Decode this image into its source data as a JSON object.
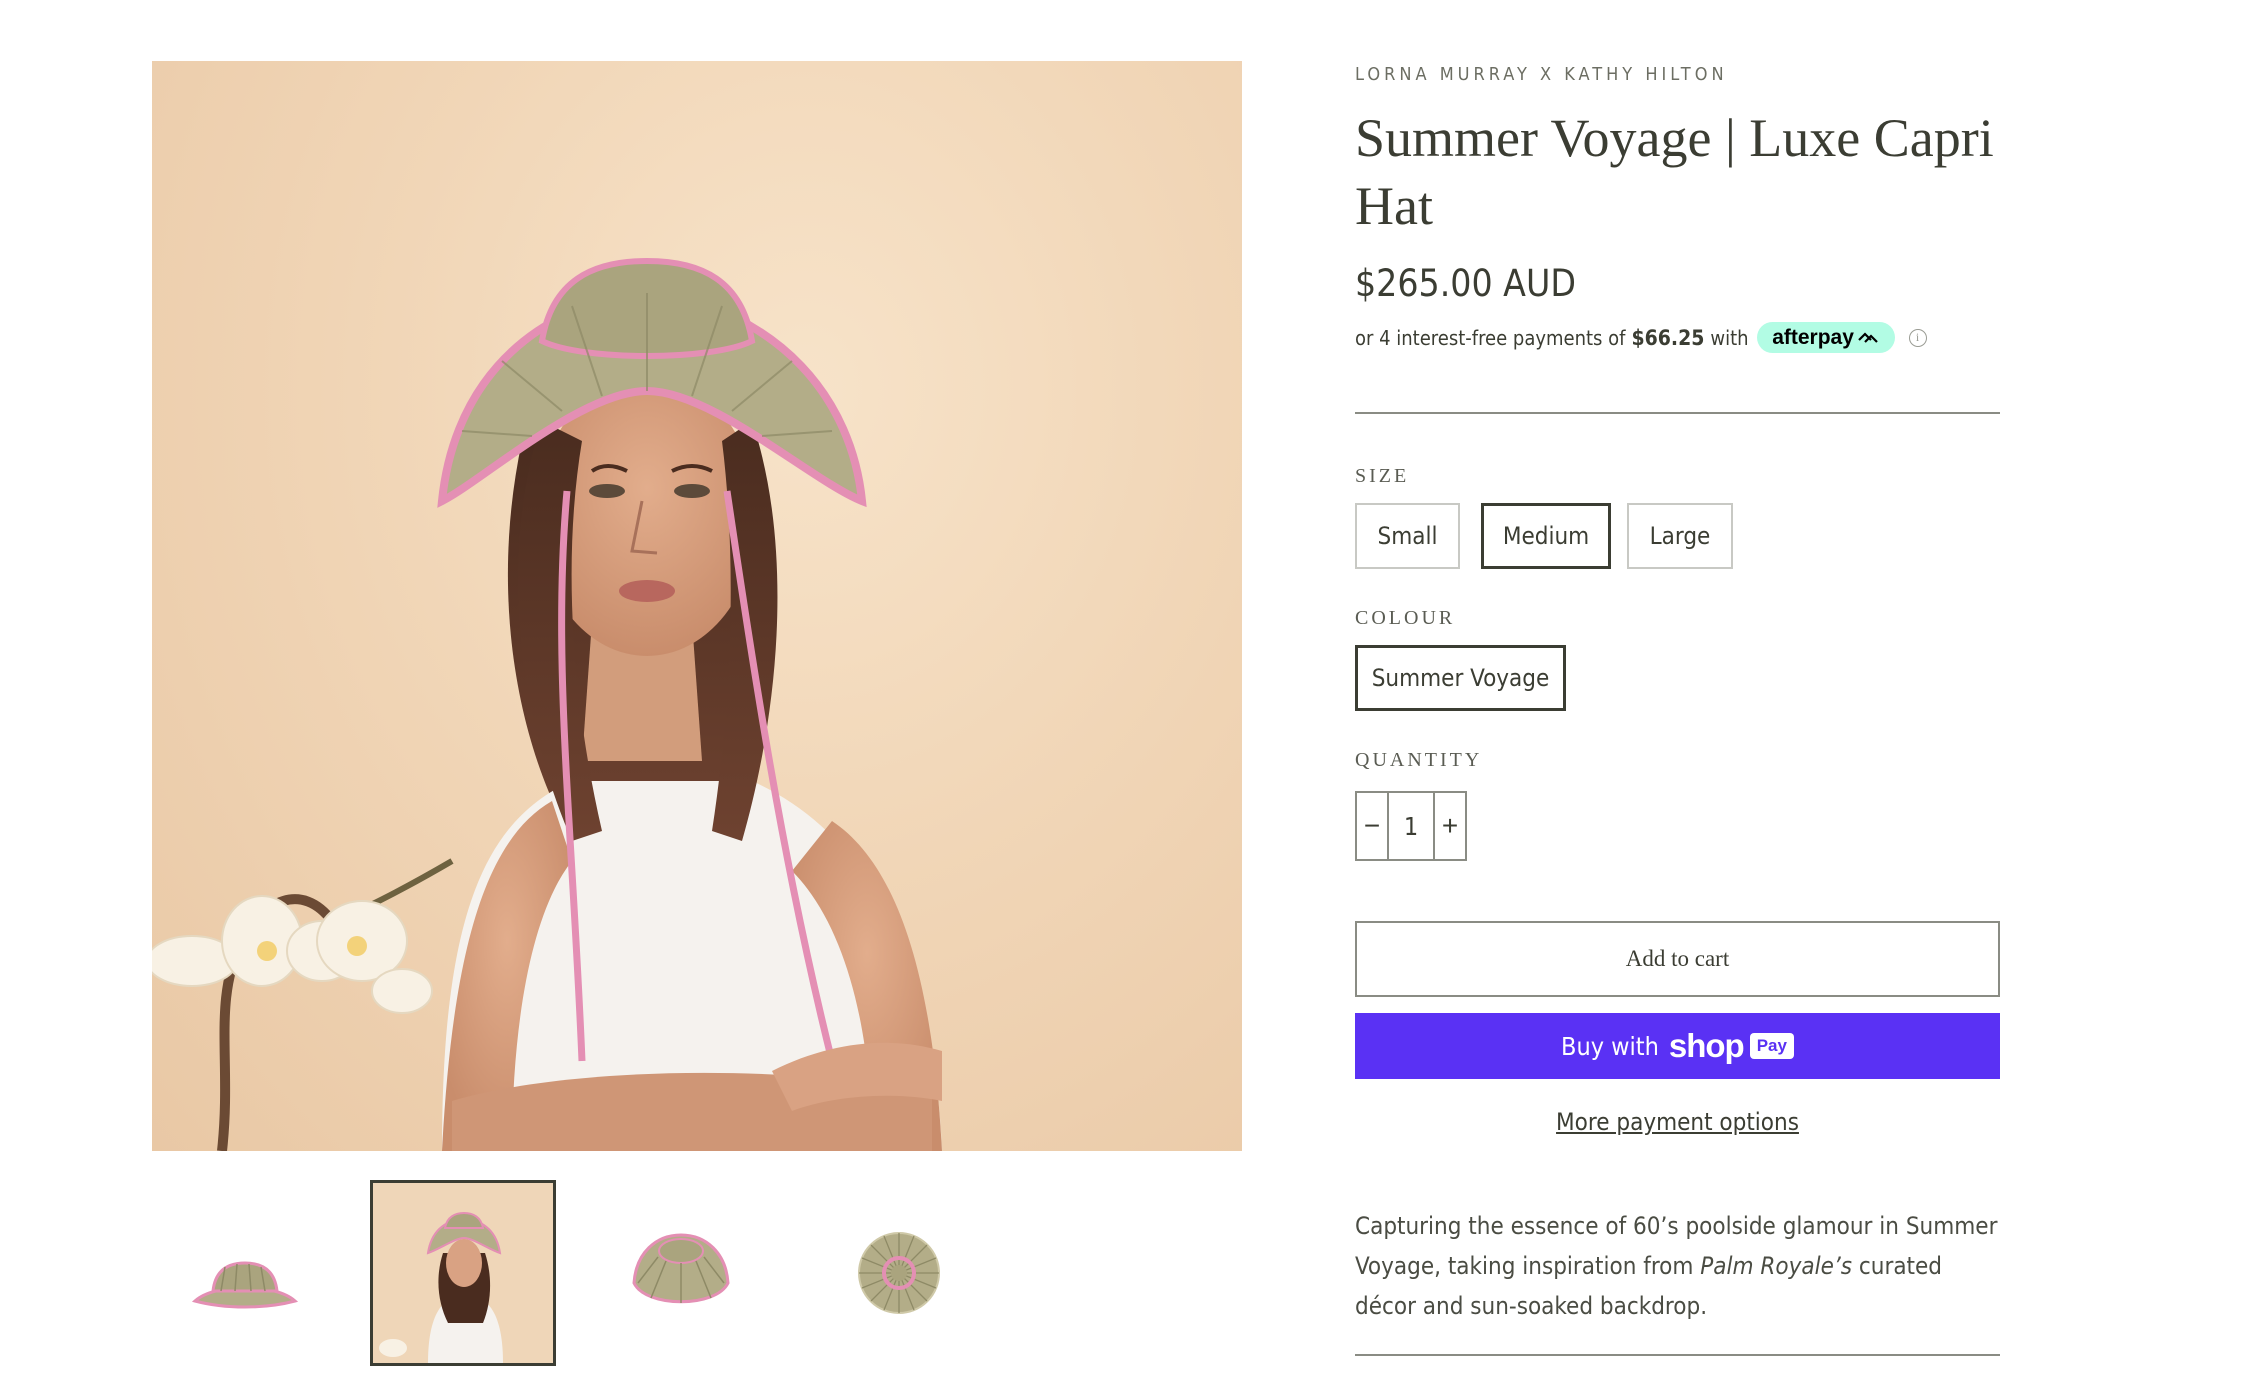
{
  "product": {
    "vendor": "LORNA MURRAY X KATHY HILTON",
    "title": "Summer Voyage | Luxe Capri Hat",
    "price": "$265.00 AUD",
    "afterpay": {
      "prefix": "or 4 interest-free payments of",
      "amount": "$66.25",
      "suffix": "with",
      "brand": "afterpay",
      "info": "i"
    }
  },
  "options": {
    "size": {
      "label": "SIZE",
      "values": [
        "Small",
        "Medium",
        "Large"
      ],
      "selected": "Medium"
    },
    "colour": {
      "label": "COLOUR",
      "values": [
        "Summer Voyage"
      ],
      "selected": "Summer Voyage"
    },
    "quantity": {
      "label": "QUANTITY",
      "value": "1",
      "decrement": "−",
      "increment": "+"
    }
  },
  "actions": {
    "add_to_cart": "Add to cart",
    "buy_with": "Buy with",
    "shop_brand": "shop",
    "pay_badge": "Pay",
    "more_payment": "More payment options"
  },
  "description": {
    "part1": "Capturing the essence of 60’s poolside glamour in Summer Voyage, taking inspiration from ",
    "italic": "Palm Royale’s",
    "part2": " curated décor and sun-soaked backdrop."
  },
  "gallery": {
    "thumbnails": [
      "hat-side-view",
      "model-wearing-hat",
      "hat-top-angle",
      "hat-top-down"
    ],
    "active_index": 1
  },
  "colors": {
    "text": "#3b3d33",
    "shop_pay": "#5a31f4",
    "afterpay_badge": "#b2fce4",
    "hat_straw": "#b3ad88",
    "hat_trim": "#e48fb4"
  }
}
